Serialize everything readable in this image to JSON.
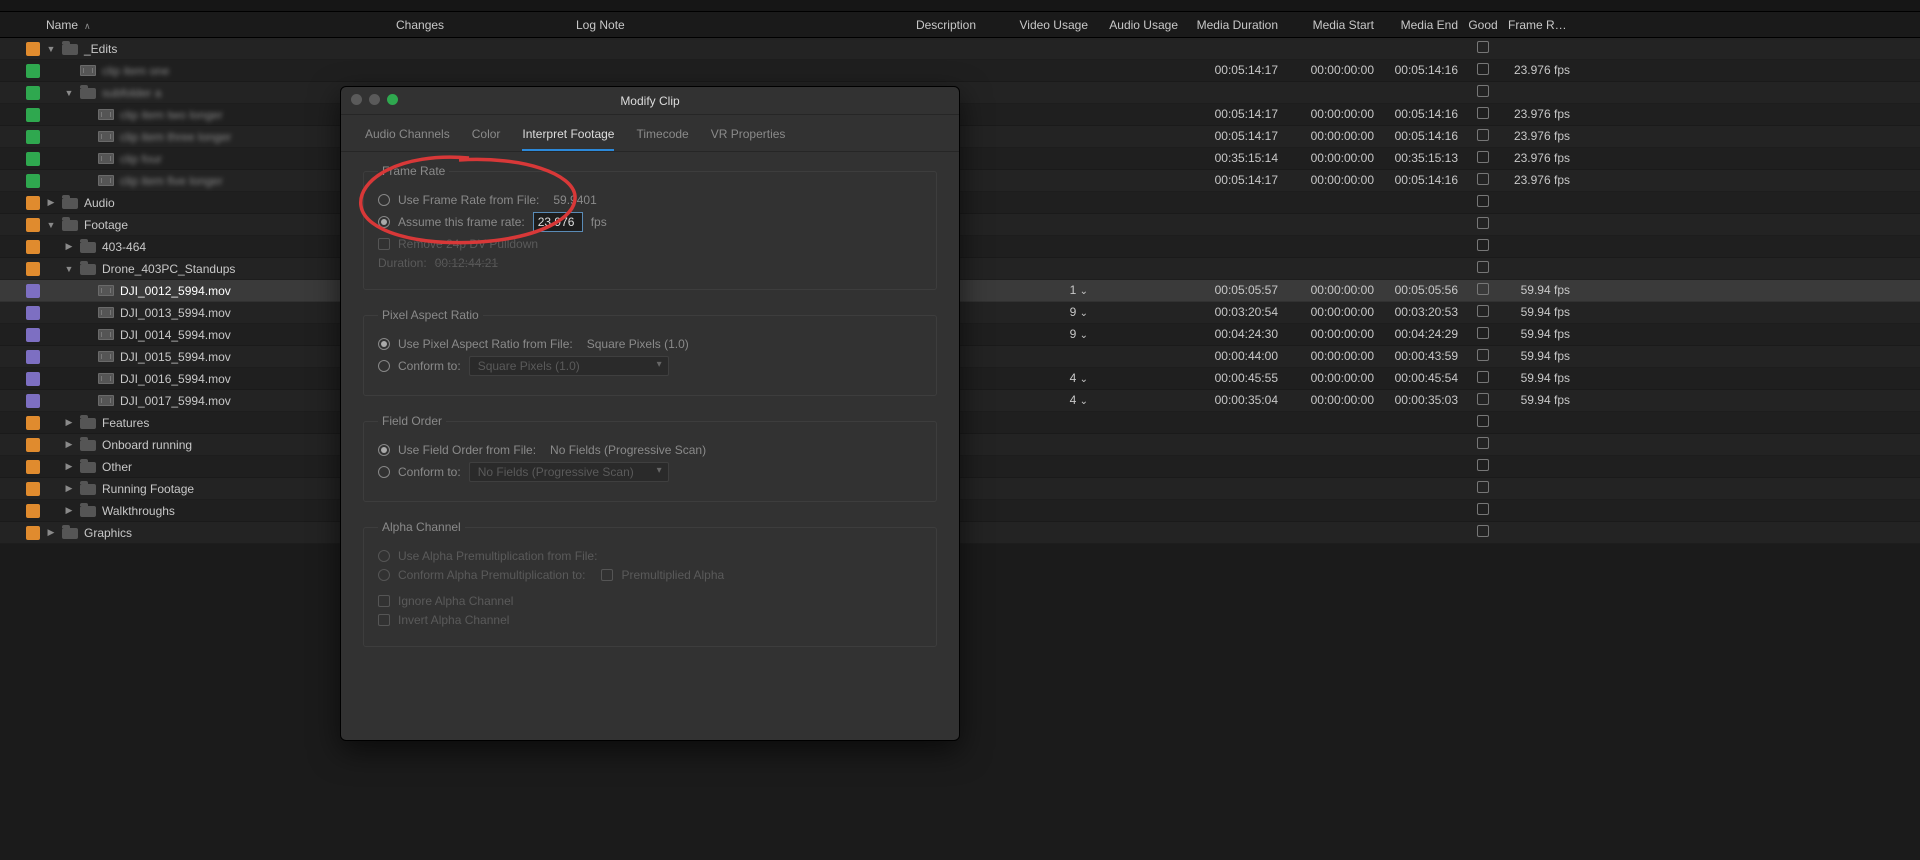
{
  "columns": {
    "name": "Name",
    "changes": "Changes",
    "log": "Log Note",
    "desc": "Description",
    "video_usage": "Video Usage",
    "audio_usage": "Audio Usage",
    "media_duration": "Media Duration",
    "media_start": "Media Start",
    "media_end": "Media End",
    "good": "Good",
    "frame_rate": "Frame Rate"
  },
  "rows": [
    {
      "chip": "orange",
      "indent": 1,
      "twisty": "down",
      "type": "folder",
      "label": "_Edits"
    },
    {
      "chip": "green",
      "indent": 2,
      "blur": true,
      "type": "clip",
      "label": "clip item one",
      "md": "00:05:14:17",
      "ms": "00:00:00:00",
      "me": "00:05:14:16",
      "fr": "23.976 fps"
    },
    {
      "chip": "green",
      "indent": 2,
      "twisty": "down",
      "blur": true,
      "type": "folder",
      "label": "subfolder a"
    },
    {
      "chip": "green",
      "indent": 3,
      "blur": true,
      "type": "clip",
      "label": "clip item two longer",
      "md": "00:05:14:17",
      "ms": "00:00:00:00",
      "me": "00:05:14:16",
      "fr": "23.976 fps"
    },
    {
      "chip": "green",
      "indent": 3,
      "blur": true,
      "type": "clip",
      "label": "clip item three longer",
      "md": "00:05:14:17",
      "ms": "00:00:00:00",
      "me": "00:05:14:16",
      "fr": "23.976 fps"
    },
    {
      "chip": "green",
      "indent": 3,
      "blur": true,
      "type": "clip",
      "label": "clip four",
      "md": "00:35:15:14",
      "ms": "00:00:00:00",
      "me": "00:35:15:13",
      "fr": "23.976 fps"
    },
    {
      "chip": "green",
      "indent": 3,
      "blur": true,
      "type": "clip",
      "label": "clip item five longer",
      "md": "00:05:14:17",
      "ms": "00:00:00:00",
      "me": "00:05:14:16",
      "fr": "23.976 fps"
    },
    {
      "chip": "orange",
      "indent": 1,
      "twisty": "right",
      "type": "folder",
      "label": "Audio"
    },
    {
      "chip": "orange",
      "indent": 1,
      "twisty": "down",
      "type": "folder",
      "label": "Footage"
    },
    {
      "chip": "orange",
      "indent": 2,
      "twisty": "right",
      "type": "folder",
      "label": "403-464"
    },
    {
      "chip": "orange",
      "indent": 2,
      "twisty": "down",
      "type": "folder",
      "label": "Drone_403PC_Standups"
    },
    {
      "chip": "violet",
      "indent": 3,
      "type": "clip",
      "label": "DJI_0012_5994.mov",
      "selected": true,
      "vu": "1",
      "md": "00:05:05:57",
      "ms": "00:00:00:00",
      "me": "00:05:05:56",
      "fr": "59.94 fps"
    },
    {
      "chip": "violet",
      "indent": 3,
      "type": "clip",
      "label": "DJI_0013_5994.mov",
      "vu": "9",
      "md": "00:03:20:54",
      "ms": "00:00:00:00",
      "me": "00:03:20:53",
      "fr": "59.94 fps"
    },
    {
      "chip": "violet",
      "indent": 3,
      "type": "clip",
      "label": "DJI_0014_5994.mov",
      "vu": "9",
      "md": "00:04:24:30",
      "ms": "00:00:00:00",
      "me": "00:04:24:29",
      "fr": "59.94 fps"
    },
    {
      "chip": "violet",
      "indent": 3,
      "type": "clip",
      "label": "DJI_0015_5994.mov",
      "md": "00:00:44:00",
      "ms": "00:00:00:00",
      "me": "00:00:43:59",
      "fr": "59.94 fps"
    },
    {
      "chip": "violet",
      "indent": 3,
      "type": "clip",
      "label": "DJI_0016_5994.mov",
      "vu": "4",
      "md": "00:00:45:55",
      "ms": "00:00:00:00",
      "me": "00:00:45:54",
      "fr": "59.94 fps"
    },
    {
      "chip": "violet",
      "indent": 3,
      "type": "clip",
      "label": "DJI_0017_5994.mov",
      "vu": "4",
      "md": "00:00:35:04",
      "ms": "00:00:00:00",
      "me": "00:00:35:03",
      "fr": "59.94 fps"
    },
    {
      "chip": "orange",
      "indent": 2,
      "twisty": "right",
      "type": "folder",
      "label": "Features"
    },
    {
      "chip": "orange",
      "indent": 2,
      "twisty": "right",
      "type": "folder",
      "label": "Onboard running"
    },
    {
      "chip": "orange",
      "indent": 2,
      "twisty": "right",
      "type": "folder",
      "label": "Other"
    },
    {
      "chip": "orange",
      "indent": 2,
      "twisty": "right",
      "type": "folder",
      "label": "Running Footage"
    },
    {
      "chip": "orange",
      "indent": 2,
      "twisty": "right",
      "type": "folder",
      "label": "Walkthroughs"
    },
    {
      "chip": "orange",
      "indent": 1,
      "twisty": "right",
      "type": "folder",
      "label": "Graphics"
    }
  ],
  "dialog": {
    "title": "Modify Clip",
    "tabs": {
      "audio": "Audio Channels",
      "color": "Color",
      "interpret": "Interpret Footage",
      "timecode": "Timecode",
      "vr": "VR Properties",
      "active": "interpret"
    },
    "frame_rate": {
      "legend": "Frame Rate",
      "from_file_label": "Use Frame Rate from File:",
      "from_file_value": "59.9401",
      "assume_label": "Assume this frame rate:",
      "assume_value": "23.976",
      "assume_unit": "fps",
      "remove_pulldown": "Remove 24p DV Pulldown",
      "duration_label": "Duration:",
      "duration_value": "00:12:44:21"
    },
    "par": {
      "legend": "Pixel Aspect Ratio",
      "from_file_label": "Use Pixel Aspect Ratio from File:",
      "from_file_value": "Square Pixels (1.0)",
      "conform_label": "Conform to:",
      "conform_value": "Square Pixels (1.0)"
    },
    "field": {
      "legend": "Field Order",
      "from_file_label": "Use Field Order from File:",
      "from_file_value": "No Fields (Progressive Scan)",
      "conform_label": "Conform to:",
      "conform_value": "No Fields (Progressive Scan)"
    },
    "alpha": {
      "legend": "Alpha Channel",
      "premul_file": "Use Alpha Premultiplication from File:",
      "premul_conform": "Conform Alpha Premultiplication to:",
      "premul_check": "Premultiplied Alpha",
      "ignore": "Ignore Alpha Channel",
      "invert": "Invert Alpha Channel"
    }
  }
}
